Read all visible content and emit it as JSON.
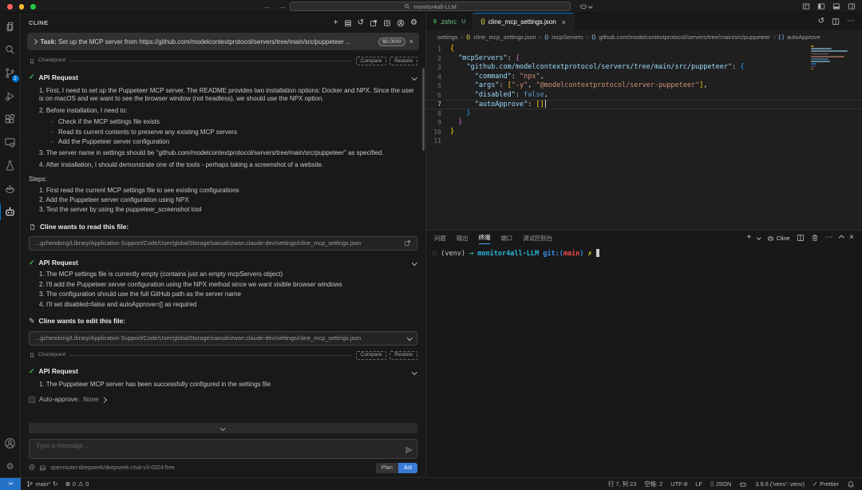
{
  "icons": {
    "back": "←",
    "forward": "→",
    "plus": "+",
    "history": "↺",
    "gear": "⚙",
    "close": "×",
    "more": "⋯",
    "sync": "↻",
    "error": "⊗",
    "warning": "⚠",
    "check": "✓",
    "cross": "✗",
    "pencil": "✎",
    "at": "@",
    "braces": "{}",
    "brackets": "[ ]",
    "dollar": "$",
    "circle": "○"
  },
  "title_bar": {
    "search": "monitor4all-LLM"
  },
  "activity_bar": {
    "scm_badge": "2"
  },
  "cline": {
    "title": "CLINE",
    "task": {
      "prefix": "Task:",
      "text": "Set up the MCP server from https://github.com/modelcontextprotocol/servers/tree/main/src/puppeteer ...",
      "cost": "$0.0000"
    },
    "checkpoint": {
      "label": "Checkpoint",
      "compare": "Compare",
      "restore": "Restore"
    },
    "request1": {
      "title": "API Request",
      "item1": "1. First, I need to set up the Puppeteer MCP server. The README provides two installation options: Docker and NPX. Since the user is on macOS and we want to see the browser window (not headless), we should use the NPX option.",
      "item2": "2. Before installation, I need to:",
      "sub1": "Check if the MCP settings file exists",
      "sub2": "Read its current contents to preserve any existing MCP servers",
      "sub3": "Add the Puppeteer server configuration",
      "item3": "3. The server name in settings should be \"github.com/modelcontextprotocol/servers/tree/main/src/puppeteer\" as specified.",
      "item4": "4. After installation, I should demonstrate one of the tools - perhaps taking a screenshot of a website.",
      "steps_label": "Steps:",
      "step1": "1. First read the current MCP settings file to see existing configurations",
      "step2": "2. Add the Puppeteer server configuration using NPX",
      "step3": "3. Test the server by using the puppeteer_screenshot tool"
    },
    "read_file": {
      "label": "Cline wants to read this file:",
      "path": "...gzhendong/Library/Application Support/Code/User/globalStorage/saoudrizwan.claude-dev/settings/cline_mcp_settings.json"
    },
    "request2": {
      "title": "API Request",
      "item1": "1. The MCP settings file is currently empty (contains just an empty mcpServers object)",
      "item2": "2. I'll add the Puppeteer server configuration using the NPX method since we want visible browser windows",
      "item3": "3. The configuration should use the full GitHub path as the server name",
      "item4": "4. I'll set disabled=false and autoApprove=[] as required"
    },
    "edit_file": {
      "label": "Cline wants to edit this file:",
      "path": "...gzhendong/Library/Application Support/Code/User/globalStorage/saoudrizwan.claude-dev/settings/cline_mcp_settings.json"
    },
    "request3": {
      "title": "API Request",
      "item1": "1. The Puppeteer MCP server has been successfully configured in the settings file"
    },
    "auto_approve": {
      "label": "Auto-approve:",
      "value": "None"
    },
    "input": {
      "placeholder": "Type a message..."
    },
    "footer": {
      "model": "openrouter:deepseek/deepseek-chat-v3-0324:free",
      "plan": "Plan",
      "act": "Act"
    }
  },
  "editor": {
    "tabs": [
      {
        "icon": "$",
        "label": ".zshrc",
        "badge": "U"
      },
      {
        "icon": "{}",
        "label": "cline_mcp_settings.json"
      }
    ],
    "breadcrumb": [
      {
        "label": "settings"
      },
      {
        "icon": "{}",
        "label": "cline_mcp_settings.json"
      },
      {
        "icon": "{}",
        "label": "mcpServers"
      },
      {
        "icon": "{}",
        "label": "github.com/modelcontextprotocol/servers/tree/main/src/puppeteer"
      },
      {
        "icon": "[ ]",
        "label": "autoApprove"
      }
    ],
    "code": {
      "active_line": 7,
      "lines": [
        {
          "num": "1",
          "tokens": [
            [
              "{",
              "gold"
            ]
          ]
        },
        {
          "num": "2",
          "tokens": [
            [
              "  ",
              ""
            ],
            [
              "\"mcpServers\"",
              "key"
            ],
            [
              ": ",
              "punct"
            ],
            [
              "{",
              "pink"
            ]
          ]
        },
        {
          "num": "3",
          "tokens": [
            [
              "    ",
              ""
            ],
            [
              "\"github.com/modelcontextprotocol/servers/tree/main/src/puppeteer\"",
              "key"
            ],
            [
              ": ",
              "punct"
            ],
            [
              "{",
              "blue"
            ]
          ]
        },
        {
          "num": "4",
          "tokens": [
            [
              "      ",
              ""
            ],
            [
              "\"command\"",
              "key"
            ],
            [
              ": ",
              "punct"
            ],
            [
              "\"npx\"",
              "str"
            ],
            [
              ",",
              "punct"
            ]
          ]
        },
        {
          "num": "5",
          "tokens": [
            [
              "      ",
              ""
            ],
            [
              "\"args\"",
              "key"
            ],
            [
              ": ",
              "punct"
            ],
            [
              "[",
              "gold"
            ],
            [
              "\"-y\"",
              "str"
            ],
            [
              ", ",
              "punct"
            ],
            [
              "\"@modelcontextprotocol/server-puppeteer\"",
              "str"
            ],
            [
              "]",
              "gold"
            ],
            [
              ",",
              "punct"
            ]
          ]
        },
        {
          "num": "6",
          "tokens": [
            [
              "      ",
              ""
            ],
            [
              "\"disabled\"",
              "key"
            ],
            [
              ": ",
              "punct"
            ],
            [
              "false",
              "kw"
            ],
            [
              ",",
              "punct"
            ]
          ]
        },
        {
          "num": "7",
          "tokens": [
            [
              "      ",
              ""
            ],
            [
              "\"autoApprove\"",
              "key"
            ],
            [
              ": ",
              "punct"
            ],
            [
              "[]",
              "gold"
            ]
          ]
        },
        {
          "num": "8",
          "tokens": [
            [
              "    ",
              ""
            ],
            [
              "}",
              "blue"
            ]
          ]
        },
        {
          "num": "9",
          "tokens": [
            [
              "  ",
              ""
            ],
            [
              "}",
              "pink"
            ]
          ]
        },
        {
          "num": "10",
          "tokens": [
            [
              "}",
              "gold"
            ]
          ]
        },
        {
          "num": "11",
          "tokens": []
        }
      ]
    }
  },
  "panel": {
    "tabs": [
      "问题",
      "输出",
      "终端",
      "端口",
      "调试控制台"
    ],
    "cline_button": "Cline"
  },
  "terminal": {
    "prompt": [
      [
        "○ ",
        "dim"
      ],
      [
        "(venv) ",
        "white"
      ],
      [
        "→  ",
        "green",
        "b"
      ],
      [
        "monitor4all-LLM ",
        "cyan",
        "b"
      ],
      [
        "git:(",
        "tblue",
        "b"
      ],
      [
        "main",
        "red",
        "b"
      ],
      [
        ") ",
        "tblue",
        "b"
      ],
      [
        "✗ ",
        "yellow"
      ]
    ]
  },
  "status_bar": {
    "branch": "main*",
    "errors": "0",
    "warnings": "0",
    "line_col": "行 7, 列 23",
    "indent": "空格: 2",
    "encoding": "UTF-8",
    "eol": "LF",
    "language": "JSON",
    "lang_icon": "{}",
    "interpreter": "3.9.6 ('venv': venv)",
    "formatter": "Prettier"
  },
  "token_colors": {
    "gold": "#ffd700",
    "pink": "#da70d6",
    "blue": "#179fff",
    "key": "#9cdcfe",
    "str": "#ce9178",
    "kw": "#569cd6",
    "punct": "#d4d4d4",
    "white": "#cccccc",
    "green": "#23d18b",
    "cyan": "#29b8db",
    "tblue": "#3b8eea",
    "red": "#f14c4c",
    "yellow": "#e5e510",
    "dim": "#5f5f5f"
  }
}
